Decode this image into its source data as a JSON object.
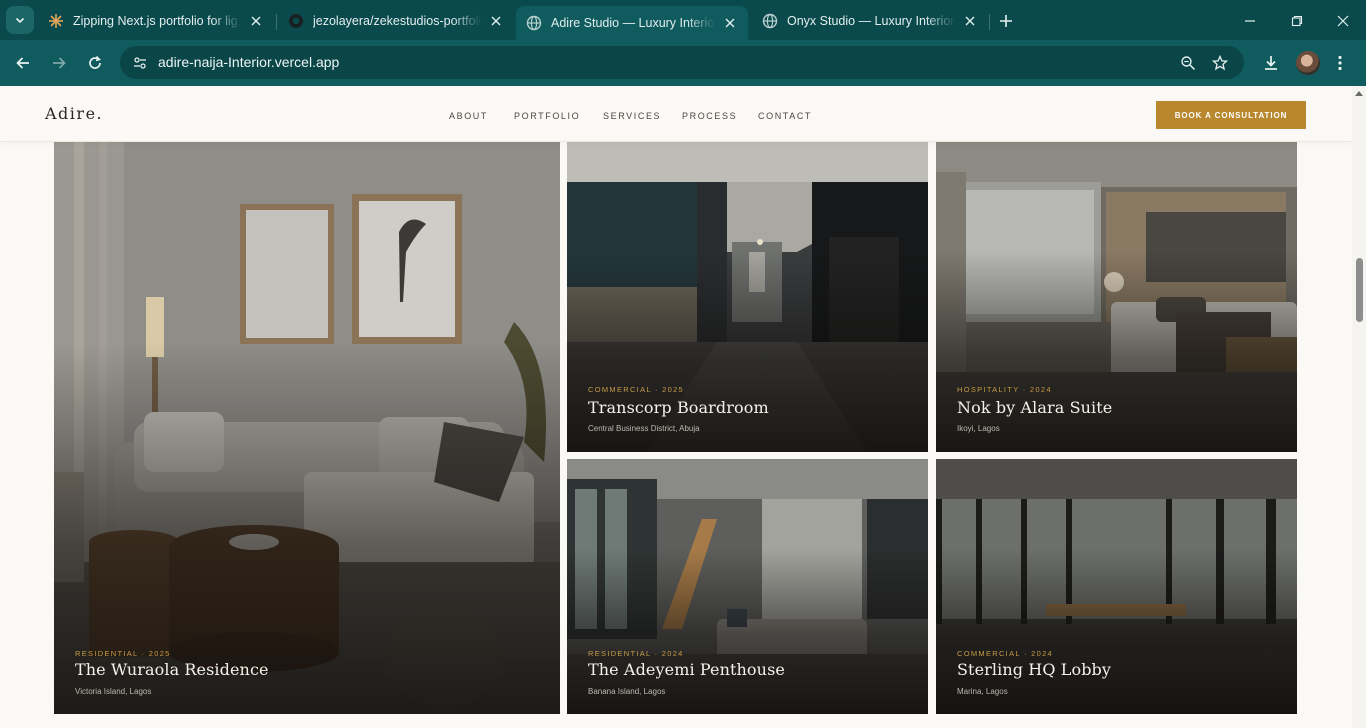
{
  "browser": {
    "tabs": [
      {
        "title": "Zipping Next.js portfolio for lig",
        "active": false,
        "favicon": "sun-icon"
      },
      {
        "title": "jezolayera/zekestudios-portfolio",
        "active": false,
        "favicon": "github-icon"
      },
      {
        "title": "Adire Studio — Luxury Interior D",
        "active": true,
        "favicon": "globe-icon"
      },
      {
        "title": "Onyx Studio — Luxury Interior D",
        "active": false,
        "favicon": "globe-icon"
      }
    ],
    "url": "adire-naija-Interior.vercel.app",
    "colors": {
      "frame": "#0a4a4c",
      "toolbar": "#0f5b5d"
    }
  },
  "site": {
    "logo": "Adire.",
    "nav": [
      "ABOUT",
      "PORTFOLIO",
      "SERVICES",
      "PROCESS",
      "CONTACT"
    ],
    "cta_label": "BOOK A CONSULTATION",
    "accent_color": "#b8872e"
  },
  "projects": [
    {
      "category": "RESIDENTIAL · 2025",
      "name": "The Wuraola Residence",
      "location": "Victoria Island, Lagos"
    },
    {
      "category": "COMMERCIAL · 2025",
      "name": "Transcorp Boardroom",
      "location": "Central Business District, Abuja"
    },
    {
      "category": "HOSPITALITY · 2024",
      "name": "Nok by Alara Suite",
      "location": "Ikoyi, Lagos"
    },
    {
      "category": "RESIDENTIAL · 2024",
      "name": "The Adeyemi Penthouse",
      "location": "Banana Island, Lagos"
    },
    {
      "category": "COMMERCIAL · 2024",
      "name": "Sterling HQ Lobby",
      "location": "Marina, Lagos"
    }
  ]
}
